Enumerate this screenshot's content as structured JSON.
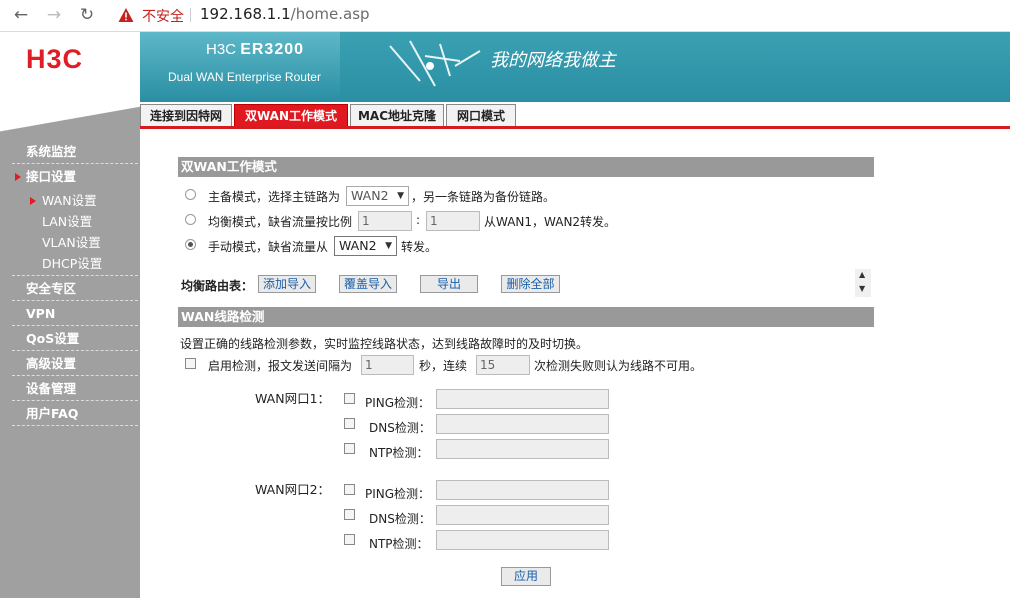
{
  "browser": {
    "insecure_label": "不安全",
    "url_host": "192.168.1.1",
    "url_path": "/home.asp"
  },
  "brand": {
    "logo": "H3C",
    "model_prefix": "H3C",
    "model": "ER3200",
    "subtitle": "Dual WAN Enterprise Router",
    "slogan": "我的网络我做主"
  },
  "tabs": [
    {
      "label": "连接到因特网",
      "active": false
    },
    {
      "label": "双WAN工作模式",
      "active": true
    },
    {
      "label": "MAC地址克隆",
      "active": false
    },
    {
      "label": "网口模式",
      "active": false
    }
  ],
  "sidebar": {
    "items": [
      {
        "label": "系统监控"
      },
      {
        "label": "接口设置",
        "active": true
      },
      {
        "label": "安全专区"
      },
      {
        "label": "VPN"
      },
      {
        "label": "QoS设置"
      },
      {
        "label": "高级设置"
      },
      {
        "label": "设备管理"
      },
      {
        "label": "用户FAQ"
      }
    ],
    "sub_items": [
      {
        "label": "WAN设置",
        "active": true
      },
      {
        "label": "LAN设置"
      },
      {
        "label": "VLAN设置"
      },
      {
        "label": "DHCP设置"
      }
    ]
  },
  "dualwan": {
    "title": "双WAN工作模式",
    "mode1_pre": "主备模式，选择主链路为",
    "mode1_select": "WAN2",
    "mode1_post": "，另一条链路为备份链路。",
    "mode2_pre": "均衡模式，缺省流量按比例",
    "mode2_val1": "1",
    "mode2_colon": ":",
    "mode2_val2": "1",
    "mode2_post": "从WAN1，WAN2转发。",
    "mode3_pre": "手动模式，缺省流量从",
    "mode3_select": "WAN2",
    "mode3_post": "转发。",
    "selected_mode": 3,
    "route_label": "均衡路由表：",
    "btn_add": "添加导入",
    "btn_cover": "覆盖导入",
    "btn_export": "导出",
    "btn_delete_all": "删除全部"
  },
  "detect": {
    "title": "WAN线路检测",
    "desc": "设置正确的线路检测参数，实时监控线路状态，达到线路故障时的及时切换。",
    "enable_pre": "启用检测，报文发送间隔为",
    "interval": "1",
    "enable_mid": "秒，连续",
    "count": "15",
    "enable_post": "次检测失败则认为线路不可用。",
    "wan1_label": "WAN网口1：",
    "wan2_label": "WAN网口2：",
    "ping_label": "PING检测：",
    "dns_label": "DNS检测：",
    "ntp_label": "NTP检测：",
    "apply": "应用"
  }
}
